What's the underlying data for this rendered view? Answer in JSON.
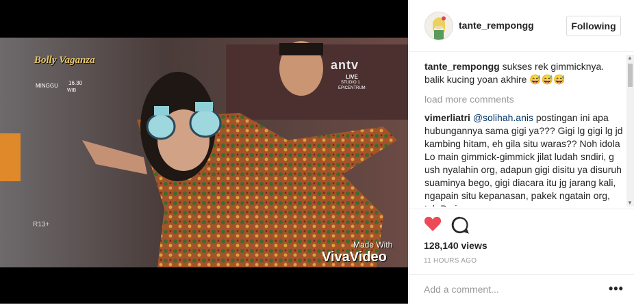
{
  "post": {
    "username": "tante_rempongg",
    "follow_label": "Following"
  },
  "video": {
    "channel_logo": "Bolly Vaganza",
    "schedule_day": "MINGGU",
    "schedule_time": "16.30",
    "schedule_tz": "WIB",
    "network": "antv",
    "live_label": "LIVE",
    "studio_label": "STUDIO 1",
    "venue_label": "EPICENTRUM",
    "rating": "R13+",
    "watermark_line1": "Made With",
    "watermark_line2": "VivaVideo"
  },
  "comments": [
    {
      "user": "tante_rempongg",
      "text": "sukses rek gimmicknya. balik kucing yoan akhire 😅😅😅"
    },
    {
      "user": "vimerliatri",
      "mention": "@solihah.anis",
      "text": "postingan ini apa hubungannya sama gigi ya??? Gigi lg gigi lg jd kambing hitam, eh gila situ waras?? Noh idola Lo main gimmick-gimmick jilat ludah sndiri, g ush nyalahin org, adapun gigi disitu ya disuruh suaminya bego, gigi diacara itu jg jarang kali, ngapain situ kepanasan, pakek ngatain org, toh Dy jg"
    }
  ],
  "load_more_label": "load more comments",
  "stats": {
    "views": "128,140 views",
    "time_ago": "11 HOURS AGO"
  },
  "add_comment_placeholder": "Add a comment...",
  "more_label": "•••",
  "icons": {
    "like": "heart-icon",
    "comment": "comment-icon",
    "more": "more-options-icon"
  },
  "colors": {
    "heart": "#ed4956",
    "text": "#262626",
    "muted": "#999999",
    "mention": "#003569"
  }
}
